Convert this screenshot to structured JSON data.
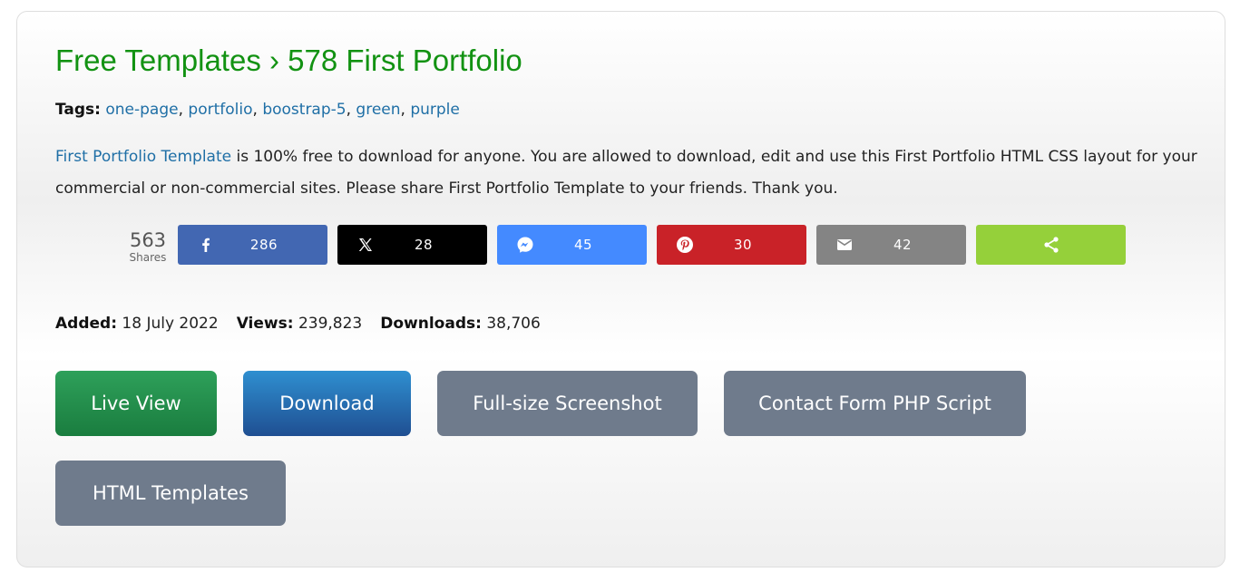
{
  "header": {
    "breadcrumb_root": "Free Templates",
    "separator": "›",
    "page_title": "578 First Portfolio"
  },
  "tags": {
    "label": "Tags:",
    "items": [
      "one-page",
      "portfolio",
      "boostrap-5",
      "green",
      "purple"
    ]
  },
  "description": {
    "link_text": "First Portfolio Template",
    "text": " is 100% free to download for anyone. You are allowed to download, edit and use this First Portfolio HTML CSS layout for your commercial or non-commercial sites. Please share First Portfolio Template to your friends. Thank you."
  },
  "share": {
    "total": "563",
    "total_label": "Shares",
    "buttons": [
      {
        "network": "facebook",
        "icon": "facebook-icon",
        "count": "286",
        "color": "#4267b2"
      },
      {
        "network": "x",
        "icon": "x-icon",
        "count": "28",
        "color": "#000000"
      },
      {
        "network": "messenger",
        "icon": "messenger-icon",
        "count": "45",
        "color": "#448aff"
      },
      {
        "network": "pinterest",
        "icon": "pinterest-icon",
        "count": "30",
        "color": "#c92228"
      },
      {
        "network": "email",
        "icon": "email-icon",
        "count": "42",
        "color": "#848484"
      },
      {
        "network": "share",
        "icon": "share-icon",
        "count": "",
        "color": "#95d03a"
      }
    ]
  },
  "stats": {
    "added_label": "Added:",
    "added_value": "18 July 2022",
    "views_label": "Views:",
    "views_value": "239,823",
    "downloads_label": "Downloads:",
    "downloads_value": "38,706"
  },
  "actions": {
    "live_view": "Live View",
    "download": "Download",
    "screenshot": "Full-size Screenshot",
    "contact_form": "Contact Form PHP Script",
    "html_templates": "HTML Templates"
  },
  "colors": {
    "title_green": "#129212",
    "link_blue": "#1f6fa6",
    "live_view_green": "#1f8a48",
    "download_blue": "#2566a8",
    "secondary_gray": "#6f7b8c"
  }
}
